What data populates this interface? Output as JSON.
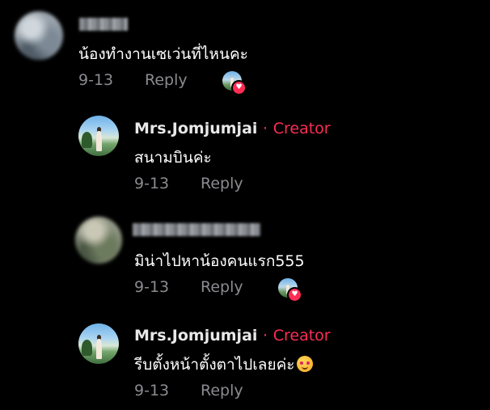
{
  "comments": [
    {
      "username_visible": false,
      "text": "น้องทำงานเซเว่นที่ไหนคะ",
      "date": "9-13",
      "reply_label": "Reply",
      "liked_by_creator": true
    },
    {
      "username": "Mrs.Jomjumjai",
      "separator": "·",
      "badge": "Creator",
      "text": "สนามบินค่ะ",
      "date": "9-13",
      "reply_label": "Reply",
      "liked_by_creator": false
    },
    {
      "username_visible": false,
      "text": "มิน่าไปหาน้องคนแรก555",
      "date": "9-13",
      "reply_label": "Reply",
      "liked_by_creator": true
    },
    {
      "username": "Mrs.Jomjumjai",
      "separator": "·",
      "badge": "Creator",
      "text": "รีบตั้งหน้าตั้งตาไปเลยค่ะ",
      "emoji": "smiling-face-with-hearts",
      "date": "9-13",
      "reply_label": "Reply",
      "liked_by_creator": false
    }
  ],
  "colors": {
    "background": "#000000",
    "creator_accent": "#fe2c55",
    "meta_text": "#8a8b8f",
    "primary_text": "#ffffff"
  }
}
